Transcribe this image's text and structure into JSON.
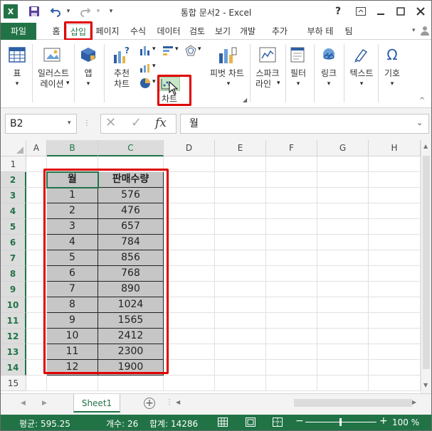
{
  "app": {
    "title": "통합 문서2 - Excel",
    "help": "?",
    "quick_access": {
      "excel_logo": "X",
      "save": "💾",
      "undo": "↶",
      "redo": "↷"
    }
  },
  "tabs": [
    {
      "label": "파일"
    },
    {
      "label": "홈"
    },
    {
      "label": "삽입"
    },
    {
      "label": "페이지"
    },
    {
      "label": "수식"
    },
    {
      "label": "데이터"
    },
    {
      "label": "검토"
    },
    {
      "label": "보기"
    },
    {
      "label": "개발"
    },
    {
      "label": "추가"
    },
    {
      "label": "부하 테"
    },
    {
      "label": "팀"
    }
  ],
  "ribbon": {
    "table": "표",
    "illustrations_1": "일러스트",
    "illustrations_2": "레이션",
    "apps": "앱",
    "recommended_1": "추천",
    "recommended_2": "차트",
    "chart": "차트",
    "pivot_chart": "피벗 차트",
    "sparkline_1": "스파크",
    "sparkline_2": "라인",
    "filter": "필터",
    "link": "링크",
    "text": "텍스트",
    "symbol": "기호",
    "symbol_glyph": "Ω"
  },
  "formula_bar": {
    "name_box": "B2",
    "cancel": "✕",
    "enter": "✓",
    "fx": "fx",
    "value": "월"
  },
  "sheet": {
    "columns": [
      "A",
      "B",
      "C",
      "D",
      "E",
      "F",
      "G",
      "H"
    ],
    "rows": [
      "1",
      "2",
      "3",
      "4",
      "5",
      "6",
      "7",
      "8",
      "9",
      "10",
      "11",
      "12",
      "13",
      "14",
      "15"
    ],
    "header": {
      "month": "월",
      "sales": "판매수량"
    },
    "data": [
      {
        "month": "1",
        "sales": "576"
      },
      {
        "month": "2",
        "sales": "476"
      },
      {
        "month": "3",
        "sales": "657"
      },
      {
        "month": "4",
        "sales": "784"
      },
      {
        "month": "5",
        "sales": "856"
      },
      {
        "month": "6",
        "sales": "768"
      },
      {
        "month": "7",
        "sales": "890"
      },
      {
        "month": "8",
        "sales": "1024"
      },
      {
        "month": "9",
        "sales": "1565"
      },
      {
        "month": "10",
        "sales": "2412"
      },
      {
        "month": "11",
        "sales": "2300"
      },
      {
        "month": "12",
        "sales": "1900"
      }
    ]
  },
  "sheet_tabs": {
    "active": "Sheet1",
    "add": "+"
  },
  "status": {
    "average": "평균: 595.25",
    "count": "개수: 26",
    "sum": "합계: 14286",
    "zoom": "100 %"
  }
}
